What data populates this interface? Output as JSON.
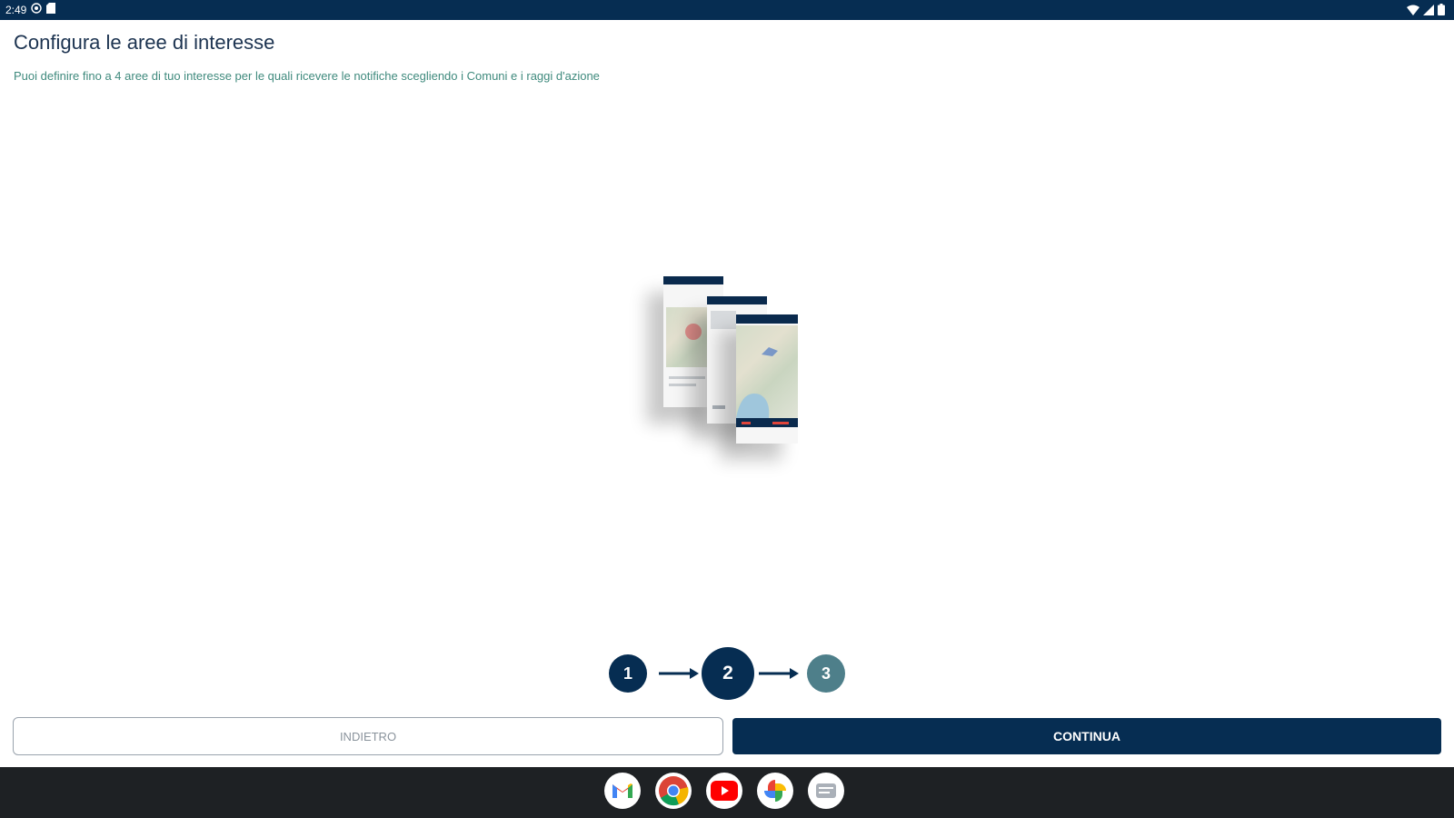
{
  "status_bar": {
    "time": "2:49",
    "left_icons": [
      "at-sign-icon",
      "sd-card-icon"
    ],
    "right_icons": [
      "wifi-icon",
      "signal-icon",
      "battery-icon"
    ]
  },
  "page": {
    "title": "Configura le aree di interesse",
    "subtitle": "Puoi definire fino a 4 aree di tuo interesse per le quali ricevere le notifiche scegliendo i Comuni e i raggi d'azione"
  },
  "illustration": {
    "icon": "app-screens-illustration"
  },
  "stepper": {
    "steps": [
      {
        "label": "1",
        "state": "done"
      },
      {
        "label": "2",
        "state": "current"
      },
      {
        "label": "3",
        "state": "upcoming"
      }
    ]
  },
  "buttons": {
    "back_label": "INDIETRO",
    "continue_label": "CONTINUA"
  },
  "dock": {
    "apps": [
      "gmail-icon",
      "chrome-icon",
      "youtube-icon",
      "photos-icon",
      "messages-icon"
    ]
  },
  "colors": {
    "primary": "#062d52",
    "step_upcoming": "#4e7f8a",
    "subtitle": "#3f8a7d",
    "nav_bar": "#1e2124"
  }
}
